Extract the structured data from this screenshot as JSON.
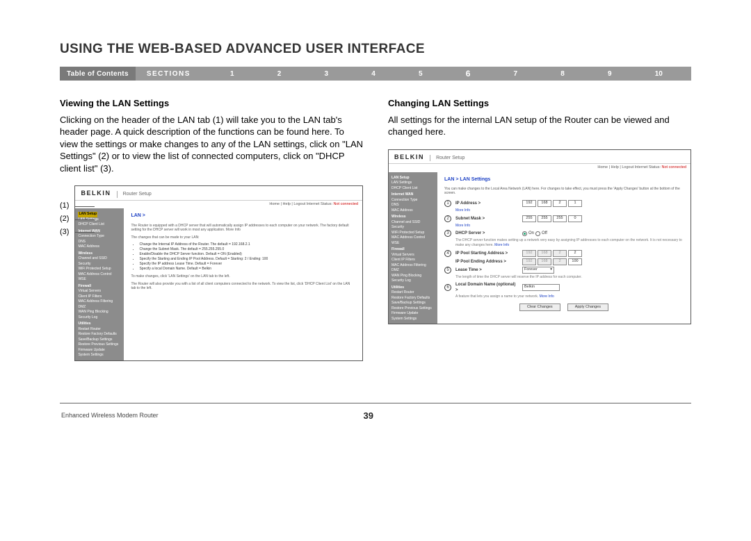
{
  "header": {
    "title": "USING THE WEB-BASED ADVANCED USER INTERFACE"
  },
  "nav": {
    "toc": "Table of Contents",
    "sections_label": "SECTIONS",
    "items": [
      "1",
      "2",
      "3",
      "4",
      "5",
      "6",
      "7",
      "8",
      "9",
      "10"
    ],
    "active": "6"
  },
  "left_col": {
    "heading": "Viewing the LAN Settings",
    "body": "Clicking on the header of the LAN tab (1) will take you to the LAN tab's header page. A quick description of the functions can be found here. To view the settings or make changes to any of the LAN settings, click on \"LAN Settings\" (2) or to view the list of connected computers, click on \"DHCP client list\" (3).",
    "callouts": [
      "(1)",
      "(2)",
      "(3)"
    ],
    "shot": {
      "brand": "BELKIN",
      "subtitle": "Router Setup",
      "status_links": "Home | Help | Logout   Internet Status:",
      "status_val": "Not connected",
      "sidebar": {
        "groups": [
          {
            "hd": "LAN Setup",
            "items": [
              "LAN Settings",
              "DHCP Client List"
            ],
            "selected": "LAN Setup"
          },
          {
            "hd": "Internet WAN",
            "items": [
              "Connection Type",
              "DNS",
              "MAC Address"
            ]
          },
          {
            "hd": "Wireless",
            "items": [
              "Channel and SSID",
              "Security",
              "WiFi Protected Setup",
              "MAC Address Control",
              "WSE"
            ]
          },
          {
            "hd": "Firewall",
            "items": [
              "Virtual Servers",
              "Client IP Filters",
              "MAC Address Filtering",
              "DMZ",
              "WAN Ping Blocking",
              "Security Log"
            ]
          },
          {
            "hd": "Utilities",
            "items": [
              "Restart Router",
              "Restore Factory Defaults",
              "Save/Backup Settings",
              "Restore Previous Settings",
              "Firmware Update",
              "System Settings"
            ]
          }
        ]
      },
      "main": {
        "title": "LAN >",
        "desc1": "The Router is equipped with a DHCP server that will automatically assign IP addresses to each computer on your network. The factory default setting for the DHCP server will work in most any application. More Info",
        "desc2": "The changes that can be made to your LAN:",
        "bullets": [
          "Change the Internal IP Address of the Router. The default = 192.168.2.1",
          "Change the Subnet Mask. The default = 255.255.255.0",
          "Enable/Disable the DHCP Server function. Default = ON (Enabled)",
          "Specify the Starting and Ending IP Pool Address. Default = Starting: 2 / Ending: 100",
          "Specify the IP address Lease Time. Default = Forever",
          "Specify a local Domain Name. Default = Belkin"
        ],
        "desc3": "To make changes, click 'LAN Settings' on the LAN tab to the left.",
        "desc4": "The Router will also provide you with a list of all client computers connected to the network. To view the list, click 'DHCP Client List' on the LAN tab to the left."
      }
    }
  },
  "right_col": {
    "heading": "Changing LAN Settings",
    "body": "All settings for the internal LAN setup of the Router can be viewed and changed here.",
    "shot": {
      "brand": "BELKIN",
      "subtitle": "Router Setup",
      "status_links": "Home | Help | Logout   Internet Status:",
      "status_val": "Not connected",
      "sidebar_same": true,
      "main": {
        "title": "LAN > LAN Settings",
        "intro": "You can make changes to the Local Area Network (LAN) here. For changes to take effect, you must press the 'Apply Changes' button at the bottom of the screen.",
        "rows": [
          {
            "n": "1",
            "label": "IP Address >",
            "fields": [
              "192",
              "168",
              "2",
              "1"
            ],
            "more": "More Info"
          },
          {
            "n": "2",
            "label": "Subnet Mask >",
            "fields": [
              "255",
              "255",
              "255",
              "0"
            ],
            "more": "More Info"
          },
          {
            "n": "3",
            "label": "DHCP Server >",
            "radio_on": "On",
            "radio_off": "Off",
            "desc": "The DHCP server function makes setting up a network very easy by assigning IP addresses to each computer on the network. It is not necessary to make any changes here.",
            "more": "More Info"
          },
          {
            "n": "4",
            "label": "IP Pool Starting Address >",
            "fields": [
              "192",
              "168",
              "2",
              "2"
            ],
            "disabled_first3": true,
            "label2": "IP Pool Ending Address >",
            "fields2": [
              "192",
              "168",
              "2",
              "100"
            ]
          },
          {
            "n": "5",
            "label": "Lease Time >",
            "select": "Forever",
            "desc": "The length of time the DHCP server will reserve the IP address for each computer."
          },
          {
            "n": "6",
            "label": "Local Domain Name (optional) >",
            "text": "Belkin",
            "desc": "A feature that lets you assign a name to your network.",
            "more": "More Info"
          }
        ],
        "buttons": {
          "clear": "Clear Changes",
          "apply": "Apply Changes"
        }
      }
    }
  },
  "footer": {
    "product": "Enhanced Wireless Modem Router",
    "page": "39"
  }
}
